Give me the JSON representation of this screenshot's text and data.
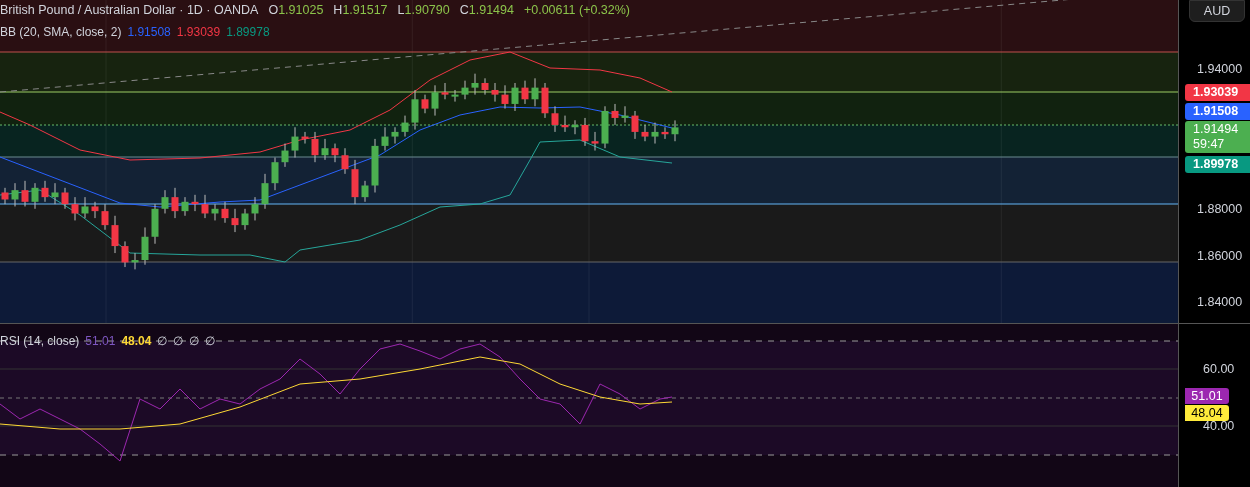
{
  "header": {
    "title": "British Pound / Australian Dollar · 1D · OANDA",
    "ohlc": [
      {
        "label": "O",
        "value": "1.91025"
      },
      {
        "label": "H",
        "value": "1.91517"
      },
      {
        "label": "L",
        "value": "1.90790"
      },
      {
        "label": "C",
        "value": "1.91494"
      }
    ],
    "change": "+0.00611 (+0.32%)"
  },
  "bb_legend": {
    "label": "BB (20, SMA, close, 2)",
    "values": [
      {
        "text": "1.91508",
        "color": "#2962ff"
      },
      {
        "text": "1.93039",
        "color": "#f23645"
      },
      {
        "text": "1.89978",
        "color": "#089981"
      }
    ]
  },
  "currency_button": "AUD",
  "price_axis": {
    "ticks": [
      "1.94000",
      "1.88000",
      "1.86000",
      "1.84000"
    ],
    "badges": [
      {
        "text": "1.93039",
        "color": "#f23645"
      },
      {
        "text": "1.91508",
        "color": "#2962ff"
      },
      {
        "text": "1.91494",
        "subtext": "59:47",
        "color": "#4caf50"
      },
      {
        "text": "1.89978",
        "color": "#089981"
      }
    ]
  },
  "rsi_legend": {
    "label": "RSI (14, close)",
    "values": [
      {
        "text": "51.01",
        "color": "#7e57c2"
      },
      {
        "text": "48.04",
        "color": "#fdd835"
      }
    ],
    "extras": [
      "∅",
      "∅",
      "∅",
      "∅"
    ]
  },
  "rsi_axis": {
    "ticks": [
      "60.00",
      "40.00"
    ],
    "badges": [
      {
        "text": "51.01",
        "color": "#9c27b0"
      },
      {
        "text": "48.04",
        "color": "#ffeb3b"
      }
    ]
  }
}
